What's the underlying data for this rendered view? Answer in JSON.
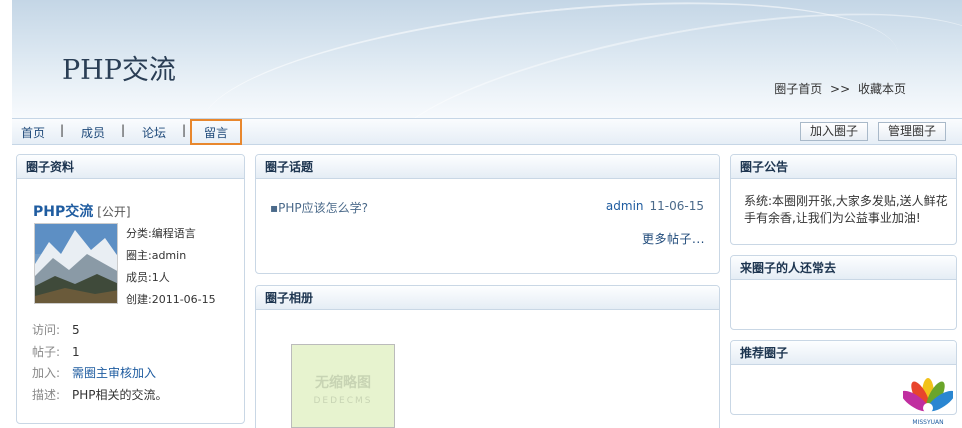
{
  "header": {
    "title": "PHP交流",
    "links": [
      "圈子首页",
      ">>",
      "收藏本页"
    ]
  },
  "nav": {
    "items": [
      "首页",
      "成员",
      "论坛",
      "留言"
    ],
    "separator": "|",
    "buttons": [
      "加入圈子",
      "管理圈子"
    ]
  },
  "info": {
    "heading": "圈子资料",
    "name": "PHP交流",
    "tag": "[公开]",
    "category": "分类:编程语言",
    "owner": "圈主:admin",
    "members": "成员:1人",
    "created": "创建:2011-06-15",
    "stats": [
      {
        "key": "访问:",
        "value": "5"
      },
      {
        "key": "帖子:",
        "value": "1"
      },
      {
        "key": "加入:",
        "value": "需圈主审核加入"
      },
      {
        "key": "描述:",
        "value": "PHP相关的交流。"
      }
    ]
  },
  "topics": {
    "heading": "圈子话题",
    "items": [
      {
        "title": "PHP应该怎么学?",
        "author": "admin",
        "date": "11-06-15"
      }
    ],
    "more": "更多帖子..."
  },
  "album": {
    "heading": "圈子相册",
    "thumb_text": "无缩略图",
    "thumb_sub": "DEDECMS"
  },
  "notice": {
    "heading": "圈子公告",
    "text": "系统:本圈刚开张,大家多发贴,送人鲜花 手有余香,让我们为公益事业加油!"
  },
  "visitors": {
    "heading": "来圈子的人还常去"
  },
  "recommend": {
    "heading": "推荐圈子"
  },
  "colors": {
    "link": "#1f5ca0",
    "nav_highlight": "#e8872d",
    "panel_border": "#c9d7e5"
  }
}
